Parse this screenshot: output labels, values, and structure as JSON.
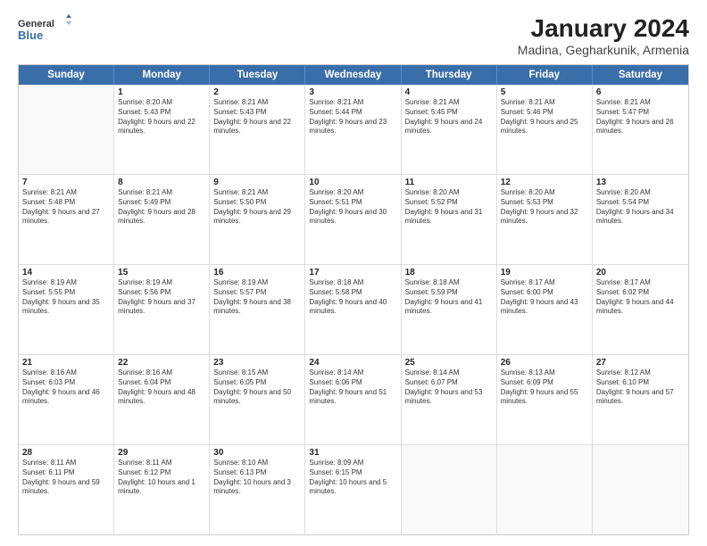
{
  "logo": {
    "line1": "General",
    "line2": "Blue"
  },
  "title": "January 2024",
  "subtitle": "Madina, Gegharkunik, Armenia",
  "header_days": [
    "Sunday",
    "Monday",
    "Tuesday",
    "Wednesday",
    "Thursday",
    "Friday",
    "Saturday"
  ],
  "weeks": [
    [
      {
        "day": "",
        "sunrise": "",
        "sunset": "",
        "daylight": ""
      },
      {
        "day": "1",
        "sunrise": "Sunrise: 8:20 AM",
        "sunset": "Sunset: 5:43 PM",
        "daylight": "Daylight: 9 hours and 22 minutes."
      },
      {
        "day": "2",
        "sunrise": "Sunrise: 8:21 AM",
        "sunset": "Sunset: 5:43 PM",
        "daylight": "Daylight: 9 hours and 22 minutes."
      },
      {
        "day": "3",
        "sunrise": "Sunrise: 8:21 AM",
        "sunset": "Sunset: 5:44 PM",
        "daylight": "Daylight: 9 hours and 23 minutes."
      },
      {
        "day": "4",
        "sunrise": "Sunrise: 8:21 AM",
        "sunset": "Sunset: 5:45 PM",
        "daylight": "Daylight: 9 hours and 24 minutes."
      },
      {
        "day": "5",
        "sunrise": "Sunrise: 8:21 AM",
        "sunset": "Sunset: 5:46 PM",
        "daylight": "Daylight: 9 hours and 25 minutes."
      },
      {
        "day": "6",
        "sunrise": "Sunrise: 8:21 AM",
        "sunset": "Sunset: 5:47 PM",
        "daylight": "Daylight: 9 hours and 26 minutes."
      }
    ],
    [
      {
        "day": "7",
        "sunrise": "Sunrise: 8:21 AM",
        "sunset": "Sunset: 5:48 PM",
        "daylight": "Daylight: 9 hours and 27 minutes."
      },
      {
        "day": "8",
        "sunrise": "Sunrise: 8:21 AM",
        "sunset": "Sunset: 5:49 PM",
        "daylight": "Daylight: 9 hours and 28 minutes."
      },
      {
        "day": "9",
        "sunrise": "Sunrise: 8:21 AM",
        "sunset": "Sunset: 5:50 PM",
        "daylight": "Daylight: 9 hours and 29 minutes."
      },
      {
        "day": "10",
        "sunrise": "Sunrise: 8:20 AM",
        "sunset": "Sunset: 5:51 PM",
        "daylight": "Daylight: 9 hours and 30 minutes."
      },
      {
        "day": "11",
        "sunrise": "Sunrise: 8:20 AM",
        "sunset": "Sunset: 5:52 PM",
        "daylight": "Daylight: 9 hours and 31 minutes."
      },
      {
        "day": "12",
        "sunrise": "Sunrise: 8:20 AM",
        "sunset": "Sunset: 5:53 PM",
        "daylight": "Daylight: 9 hours and 32 minutes."
      },
      {
        "day": "13",
        "sunrise": "Sunrise: 8:20 AM",
        "sunset": "Sunset: 5:54 PM",
        "daylight": "Daylight: 9 hours and 34 minutes."
      }
    ],
    [
      {
        "day": "14",
        "sunrise": "Sunrise: 8:19 AM",
        "sunset": "Sunset: 5:55 PM",
        "daylight": "Daylight: 9 hours and 35 minutes."
      },
      {
        "day": "15",
        "sunrise": "Sunrise: 8:19 AM",
        "sunset": "Sunset: 5:56 PM",
        "daylight": "Daylight: 9 hours and 37 minutes."
      },
      {
        "day": "16",
        "sunrise": "Sunrise: 8:19 AM",
        "sunset": "Sunset: 5:57 PM",
        "daylight": "Daylight: 9 hours and 38 minutes."
      },
      {
        "day": "17",
        "sunrise": "Sunrise: 8:18 AM",
        "sunset": "Sunset: 5:58 PM",
        "daylight": "Daylight: 9 hours and 40 minutes."
      },
      {
        "day": "18",
        "sunrise": "Sunrise: 8:18 AM",
        "sunset": "Sunset: 5:59 PM",
        "daylight": "Daylight: 9 hours and 41 minutes."
      },
      {
        "day": "19",
        "sunrise": "Sunrise: 8:17 AM",
        "sunset": "Sunset: 6:00 PM",
        "daylight": "Daylight: 9 hours and 43 minutes."
      },
      {
        "day": "20",
        "sunrise": "Sunrise: 8:17 AM",
        "sunset": "Sunset: 6:02 PM",
        "daylight": "Daylight: 9 hours and 44 minutes."
      }
    ],
    [
      {
        "day": "21",
        "sunrise": "Sunrise: 8:16 AM",
        "sunset": "Sunset: 6:03 PM",
        "daylight": "Daylight: 9 hours and 46 minutes."
      },
      {
        "day": "22",
        "sunrise": "Sunrise: 8:16 AM",
        "sunset": "Sunset: 6:04 PM",
        "daylight": "Daylight: 9 hours and 48 minutes."
      },
      {
        "day": "23",
        "sunrise": "Sunrise: 8:15 AM",
        "sunset": "Sunset: 6:05 PM",
        "daylight": "Daylight: 9 hours and 50 minutes."
      },
      {
        "day": "24",
        "sunrise": "Sunrise: 8:14 AM",
        "sunset": "Sunset: 6:06 PM",
        "daylight": "Daylight: 9 hours and 51 minutes."
      },
      {
        "day": "25",
        "sunrise": "Sunrise: 8:14 AM",
        "sunset": "Sunset: 6:07 PM",
        "daylight": "Daylight: 9 hours and 53 minutes."
      },
      {
        "day": "26",
        "sunrise": "Sunrise: 8:13 AM",
        "sunset": "Sunset: 6:09 PM",
        "daylight": "Daylight: 9 hours and 55 minutes."
      },
      {
        "day": "27",
        "sunrise": "Sunrise: 8:12 AM",
        "sunset": "Sunset: 6:10 PM",
        "daylight": "Daylight: 9 hours and 57 minutes."
      }
    ],
    [
      {
        "day": "28",
        "sunrise": "Sunrise: 8:11 AM",
        "sunset": "Sunset: 6:11 PM",
        "daylight": "Daylight: 9 hours and 59 minutes."
      },
      {
        "day": "29",
        "sunrise": "Sunrise: 8:11 AM",
        "sunset": "Sunset: 6:12 PM",
        "daylight": "Daylight: 10 hours and 1 minute."
      },
      {
        "day": "30",
        "sunrise": "Sunrise: 8:10 AM",
        "sunset": "Sunset: 6:13 PM",
        "daylight": "Daylight: 10 hours and 3 minutes."
      },
      {
        "day": "31",
        "sunrise": "Sunrise: 8:09 AM",
        "sunset": "Sunset: 6:15 PM",
        "daylight": "Daylight: 10 hours and 5 minutes."
      },
      {
        "day": "",
        "sunrise": "",
        "sunset": "",
        "daylight": ""
      },
      {
        "day": "",
        "sunrise": "",
        "sunset": "",
        "daylight": ""
      },
      {
        "day": "",
        "sunrise": "",
        "sunset": "",
        "daylight": ""
      }
    ]
  ]
}
